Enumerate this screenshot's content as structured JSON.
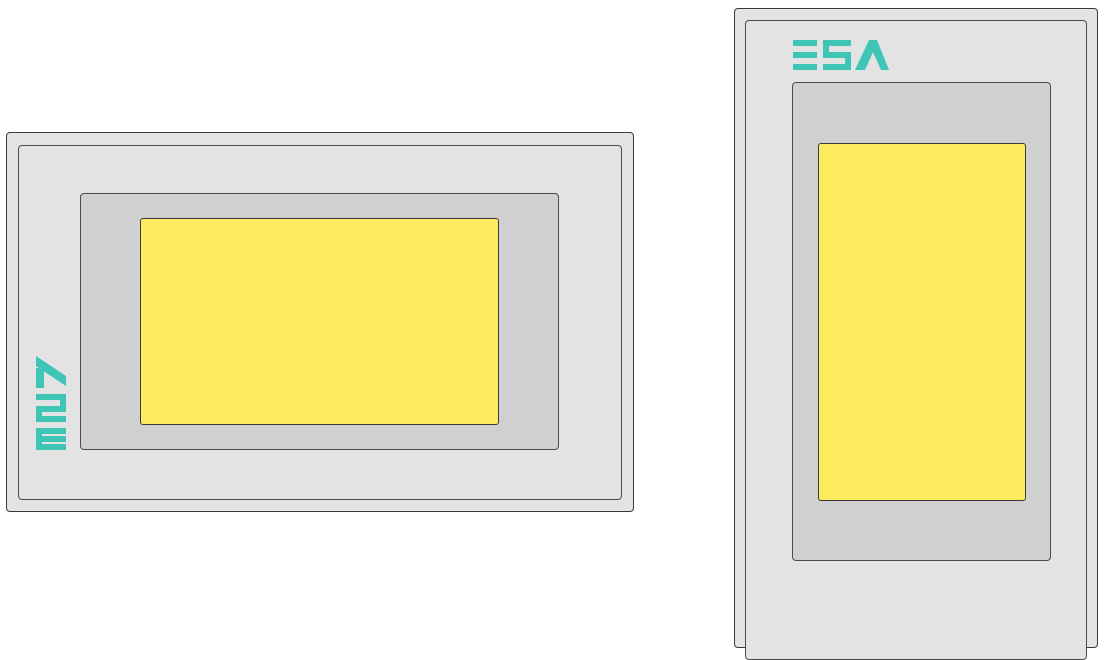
{
  "colors": {
    "panel": "#e3e3e3",
    "bezel": "#d0d0d0",
    "screen": "#fdec60",
    "logo": "#3ec5b6",
    "outline": "#3c3c3c"
  },
  "landscape_panel": {
    "logo_text": "ESA",
    "logo_orientation": "rotated-vertical"
  },
  "portrait_panel": {
    "logo_text": "ESA",
    "logo_orientation": "horizontal"
  }
}
